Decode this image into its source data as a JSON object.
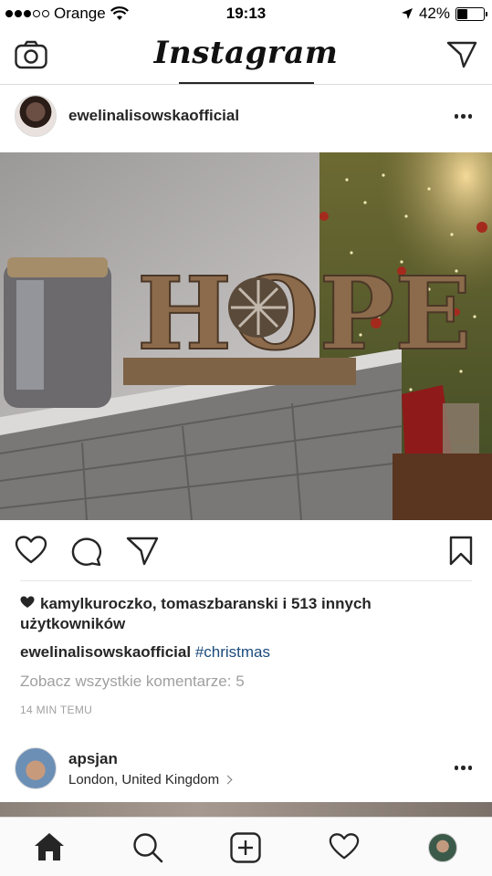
{
  "status_bar": {
    "carrier": "Orange",
    "time": "19:13",
    "battery": "42%",
    "battery_level": 0.42
  },
  "header": {
    "logo": "Instagram",
    "icons": [
      "camera-icon",
      "direct-message-icon"
    ]
  },
  "post": {
    "username": "ewelinalisowskaofficial",
    "likes_text": "kamylkuroczko, tomaszbaranski i 513 innych użytkowników",
    "caption_user": "ewelinalisowskaofficial",
    "caption_tag": "#christmas",
    "view_comments": "Zobacz wszystkie komentarze: 5",
    "timestamp": "14 MIN TEMU",
    "photo_text": "HOPE",
    "action_icons": [
      "heart-icon",
      "comment-icon",
      "share-icon",
      "bookmark-icon"
    ]
  },
  "post2": {
    "username": "apsjan",
    "location": "London, United Kingdom"
  },
  "tab_bar": {
    "icons": [
      "home-icon",
      "search-icon",
      "add-icon",
      "activity-icon",
      "profile-avatar"
    ]
  },
  "colors": {
    "text": "#262626",
    "muted": "#a0a0a0",
    "hashtag": "#1b4b7c",
    "divider": "#dbdbdb"
  }
}
